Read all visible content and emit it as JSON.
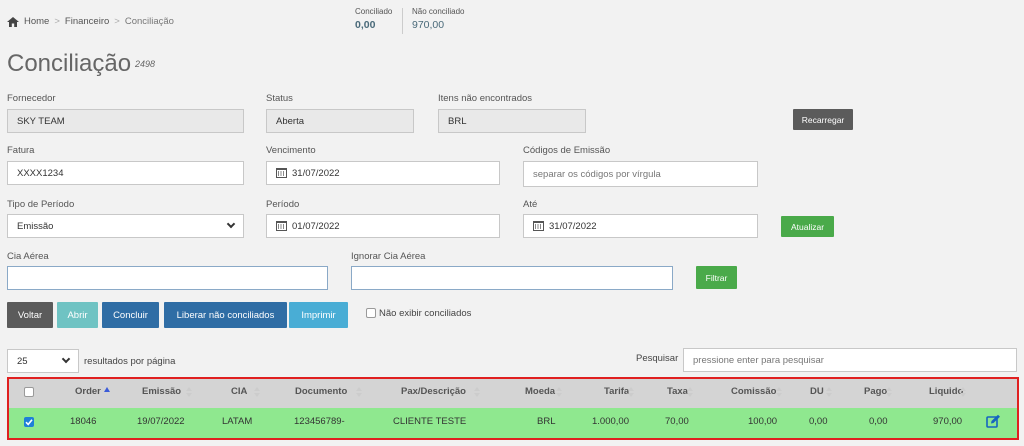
{
  "breadcrumb": {
    "home": "Home",
    "sep": ">",
    "financeiro": "Financeiro",
    "current": "Conciliação"
  },
  "summary": {
    "conciliado_label": "Conciliado",
    "conciliado_value": "0,00",
    "nao_conciliado_label": "Não conciliado",
    "nao_conciliado_value": "970,00"
  },
  "page": {
    "title": "Conciliação",
    "id": "2498"
  },
  "form": {
    "fornecedor_label": "Fornecedor",
    "fornecedor_value": "SKY TEAM",
    "status_label": "Status",
    "status_value": "Aberta",
    "itens_label": "Itens não encontrados",
    "itens_value": "BRL",
    "recarregar": "Recarregar",
    "fatura_label": "Fatura",
    "fatura_value": "XXXX1234",
    "vencimento_label": "Vencimento",
    "vencimento_value": "31/07/2022",
    "codigos_label": "Códigos de Emissão",
    "codigos_placeholder": "separar os códigos por vírgula",
    "tipo_label": "Tipo de Período",
    "tipo_value": "Emissão",
    "periodo_label": "Período",
    "periodo_value": "01/07/2022",
    "ate_label": "Até",
    "ate_value": "31/07/2022",
    "atualizar": "Atualizar",
    "cia_label": "Cia Aérea",
    "ignorar_label": "Ignorar Cia Aérea",
    "filtrar": "Filtrar"
  },
  "actions": {
    "voltar": "Voltar",
    "abrir": "Abrir",
    "concluir": "Concluir",
    "liberar": "Liberar não conciliados",
    "imprimir": "Imprimir",
    "nao_exibir": "Não exibir conciliados"
  },
  "table_controls": {
    "page_size": "25",
    "resultados": "resultados por página",
    "pesquisar_label": "Pesquisar",
    "pesquisar_placeholder": "pressione enter para pesquisar"
  },
  "table": {
    "columns": [
      "Order",
      "Emissão",
      "CIA",
      "Documento",
      "Pax/Descrição",
      "Moeda",
      "Tarifa",
      "Taxa",
      "Comissão",
      "DU",
      "Pago",
      "Liquido"
    ],
    "rows": [
      [
        "18046",
        "19/07/2022",
        "LATAM",
        "123456789-",
        "CLIENTE TESTE",
        "BRL",
        "1.000,00",
        "70,00",
        "100,00",
        "0,00",
        "0,00",
        "970,00"
      ]
    ]
  },
  "colors": {
    "highlight_border": "#e02020",
    "row_green": "#8fe88f",
    "header_bg": "#d4d4d4",
    "sort_active": "#3b5bd8"
  },
  "icons": [
    "home-icon",
    "calendar-icon",
    "chevron-down-icon",
    "sort-icon",
    "edit-icon"
  ]
}
